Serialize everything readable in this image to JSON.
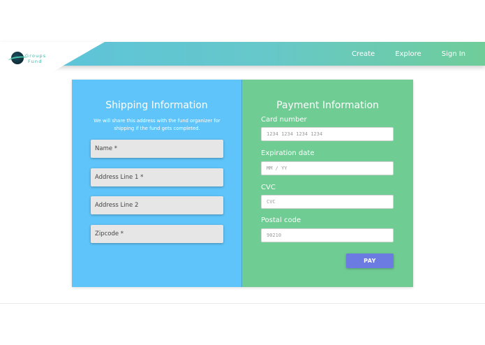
{
  "nav": {
    "logo_text_line1": "Groups",
    "logo_text_line2": "Fund",
    "links": [
      "Create",
      "Explore",
      "Sign In"
    ]
  },
  "shipping": {
    "title": "Shipping Information",
    "description": "We will share this address with the fund organizer for shipping if the fund gets completed.",
    "fields": [
      "Name *",
      "Address Line 1 *",
      "Address Line 2",
      "Zipcode *"
    ]
  },
  "payment": {
    "title": "Payment Information",
    "card_number_label": "Card number",
    "card_number_placeholder": "1234 1234 1234 1234",
    "expiration_label": "Expiration date",
    "expiration_placeholder": "MM / YY",
    "cvc_label": "CVC",
    "cvc_placeholder": "CVC",
    "postal_label": "Postal code",
    "postal_placeholder": "90210",
    "pay_button": "PAY"
  },
  "colors": {
    "shipping_panel": "#5fc4f9",
    "payment_panel": "#6fcc93",
    "pay_button": "#6b7be2",
    "nav_gradient_start": "#5bc2de",
    "nav_gradient_end": "#6fcd99"
  }
}
